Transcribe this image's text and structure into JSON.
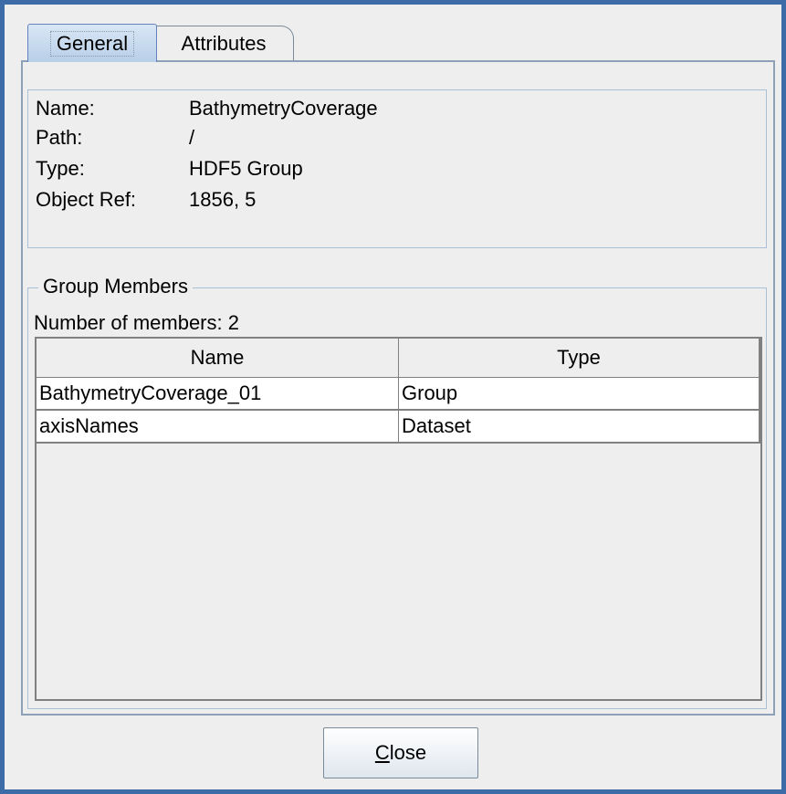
{
  "tabs": [
    {
      "label": "General",
      "selected": true
    },
    {
      "label": "Attributes",
      "selected": false
    }
  ],
  "info": {
    "name_label": "Name:",
    "name_value": "BathymetryCoverage",
    "path_label": "Path:",
    "path_value": "/",
    "type_label": "Type:",
    "type_value": "HDF5 Group",
    "objref_label": "Object Ref:",
    "objref_value": "1856, 5"
  },
  "group_members": {
    "legend": "Group Members",
    "count_text": "Number of members: 2",
    "columns": [
      "Name",
      "Type"
    ],
    "rows": [
      {
        "name": "BathymetryCoverage_01",
        "type": "Group"
      },
      {
        "name": "axisNames",
        "type": "Dataset"
      }
    ]
  },
  "close_button": {
    "mnemonic": "C",
    "rest": "lose"
  },
  "colors": {
    "window_border": "#3d6ba8",
    "selected_tab": "#b8cfe8",
    "background": "#eeeeee"
  }
}
